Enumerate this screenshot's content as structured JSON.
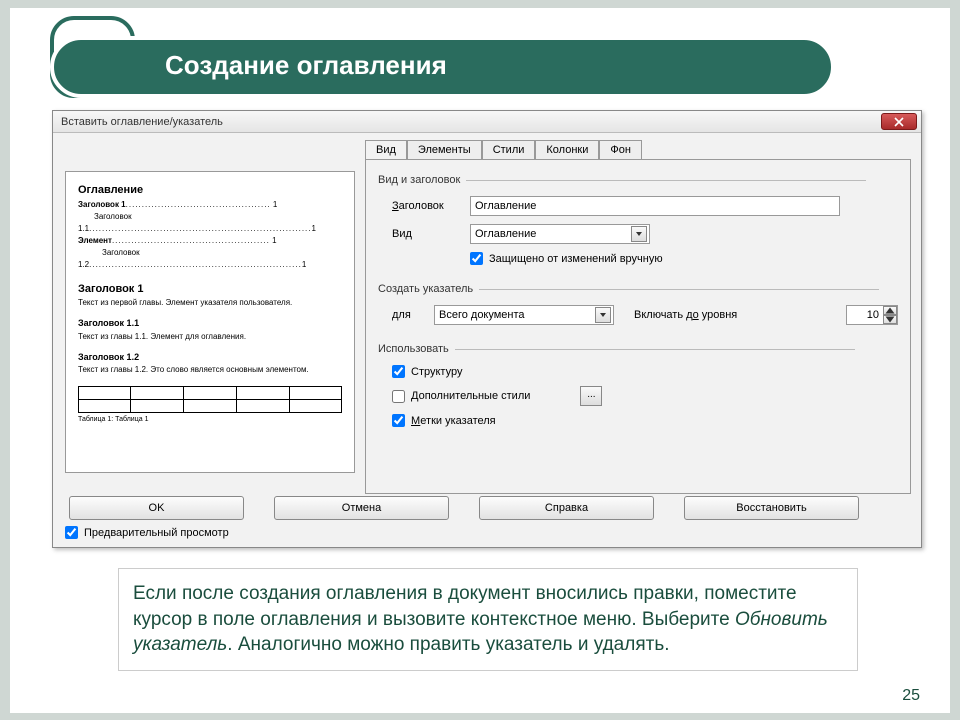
{
  "slide": {
    "title": "Создание оглавления",
    "page_number": "25"
  },
  "dialog": {
    "title": "Вставить оглавление/указатель",
    "tabs": [
      "Вид",
      "Элементы",
      "Стили",
      "Колонки",
      "Фон"
    ],
    "group_view": "Вид и заголовок",
    "label_heading": "Заголовок",
    "value_heading": "Оглавление",
    "label_type": "Вид",
    "value_type": "Оглавление",
    "chk_protected": "Защищено от изменений вручную",
    "group_create": "Создать указатель",
    "label_for": "для",
    "value_for": "Всего документа",
    "label_level": "Включать до уровня",
    "value_level": "10",
    "group_use": "Использовать",
    "chk_structure": "Структуру",
    "chk_extra_styles": "Дополнительные стили",
    "chk_marks": "Метки указателя",
    "btn_ellipsis": "...",
    "buttons": {
      "ok": "OK",
      "cancel": "Отмена",
      "help": "Справка",
      "reset": "Восстановить"
    },
    "chk_preview": "Предварительный просмотр"
  },
  "preview": {
    "toc_title": "Оглавление",
    "l1": "Заголовок 1",
    "l1a": "Заголовок 1.1",
    "l1b": "Заголовок 1.2",
    "l2": "Элемент",
    "pg1": "1",
    "h1": "Заголовок 1",
    "t1": "Текст из первой главы. Элемент указателя пользователя.",
    "h11": "Заголовок 1.1",
    "t11": "Текст из главы 1.1. Элемент для оглавления.",
    "h12": "Заголовок 1.2",
    "t12": "Текст из главы 1.2. Это слово является основным элементом.",
    "tbl_caption": "Таблица 1: Таблица 1"
  },
  "note": {
    "line1": "Если после создания оглавления в документ вносились правки, поместите курсор в поле оглавления и вызовите контекстное меню. Выберите ",
    "em": "Обновить указатель",
    "line2": ". Аналогично можно править указатель и удалять."
  }
}
